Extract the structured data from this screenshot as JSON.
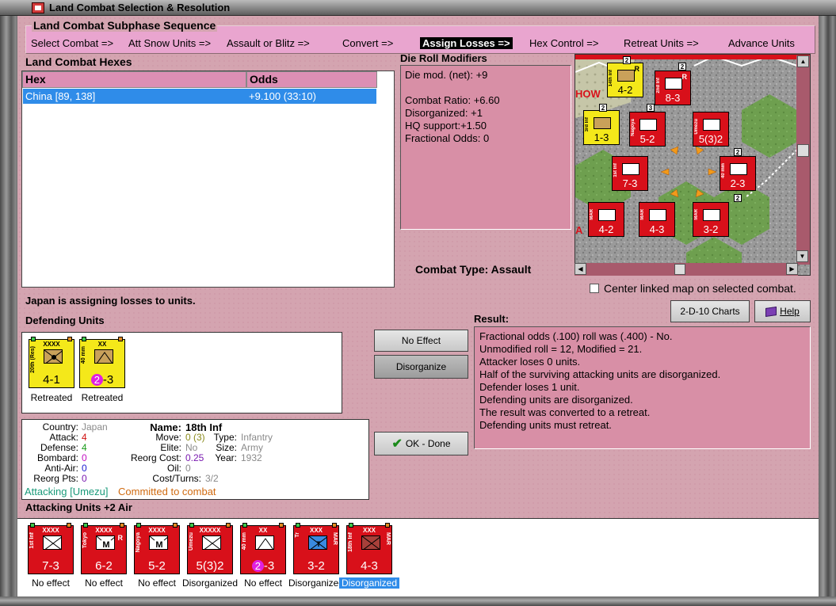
{
  "window": {
    "title": "Land Combat Selection & Resolution"
  },
  "subphase": {
    "title": "Land Combat Subphase Sequence",
    "phases": [
      "Select Combat =>",
      "Att Snow Units =>",
      "Assault or Blitz =>",
      "Convert =>",
      "Assign Losses =>",
      "Hex Control =>",
      "Retreat Units =>",
      "Advance Units"
    ],
    "active_index": 4
  },
  "hexes": {
    "title": "Land Combat Hexes",
    "columns": [
      "Hex",
      "Odds"
    ],
    "rows": [
      {
        "hex": "China [89, 138]",
        "odds": "+9.100 (33:10)"
      }
    ]
  },
  "die_roll": {
    "title": "Die Roll Modifiers",
    "lines": [
      "Die mod. (net): +9",
      "",
      "Combat Ratio: +6.60",
      "Disorganized: +1",
      "HQ support:+1.50",
      "Fractional Odds: 0"
    ]
  },
  "combat_type": "Combat Type:  Assault",
  "center_linked_label": "Center linked map on selected combat.",
  "buttons": {
    "charts": "2-D-10 Charts",
    "help": "Help",
    "no_effect": "No Effect",
    "disorganize": "Disorganize",
    "ok_done": "OK - Done"
  },
  "status_message": "Japan is assigning losses to units.",
  "defending": {
    "title": "Defending Units",
    "units": [
      {
        "size": "XXXX",
        "name": "20th (Res)",
        "strength": "4-1",
        "status": "Retreated",
        "type": "air"
      },
      {
        "size": "XX",
        "name": "40 mm",
        "strength": "2-3",
        "status": "Retreated",
        "type": "aa"
      }
    ]
  },
  "details": {
    "country_label": "Country:",
    "country": "Japan",
    "attack_label": "Attack:",
    "attack": "4",
    "defense_label": "Defense:",
    "defense": "4",
    "bombard_label": "Bombard:",
    "bombard": "0",
    "antiair_label": "Anti-Air:",
    "antiair": "0",
    "reorg_pts_label": "Reorg Pts:",
    "reorg_pts": "0",
    "name_label": "Name:",
    "name": "18th Inf",
    "move_label": "Move:",
    "move": "0 (3)",
    "type_label": "Type:",
    "type": "Infantry",
    "elite_label": "Elite:",
    "elite": "No",
    "size_label": "Size:",
    "size": "Army",
    "reorg_cost_label": "Reorg Cost:",
    "reorg_cost": "0.25",
    "year_label": "Year:",
    "year": "1932",
    "oil_label": "Oil:",
    "oil": "0",
    "cost_turns_label": "Cost/Turns:",
    "cost_turns": "3/2",
    "attacking": "Attacking [Umezu]",
    "committed": "Committed to combat"
  },
  "result": {
    "title": "Result:",
    "lines": [
      "Fractional odds (.100) roll was (.400)  - No.",
      "Unmodified roll = 12, Modified = 21.",
      "Attacker loses 0 units.",
      "Half of the surviving attacking units are disorganized.",
      "Defender loses 1 unit.",
      "Defending units are disorganized.",
      "The result was converted to a retreat.",
      "Defending units must retreat."
    ]
  },
  "attacking": {
    "title": "Attacking Units +2 Air",
    "units": [
      {
        "size": "XXXX",
        "name": "1st Inf",
        "strength": "7-3",
        "status": "No effect",
        "type": "inf"
      },
      {
        "size": "XXXX",
        "name": "Tokyo",
        "strength": "6-2",
        "status": "No effect",
        "type": "mech",
        "reserve": "R"
      },
      {
        "size": "XXXX",
        "name": "Nagoya",
        "strength": "5-2",
        "status": "No effect",
        "type": "mech"
      },
      {
        "size": "XXXXX",
        "name": "Umezu",
        "strength": "5(3)2",
        "status": "Disorganized",
        "type": "inf"
      },
      {
        "size": "XX",
        "name": "40 mm",
        "strength": "2-3",
        "status": "No effect",
        "type": "aa"
      },
      {
        "size": "XXX",
        "name": "Tr",
        "strength": "3-2",
        "status": "Disorganized",
        "type": "marine",
        "tag": "MAR"
      },
      {
        "size": "XXX",
        "name": "18th Inf",
        "strength": "4-3",
        "status": "Disorganized",
        "type": "inf",
        "tag": "MAR",
        "selected": true
      }
    ]
  },
  "map": {
    "labels": [
      "HOW",
      "A"
    ],
    "counters": [
      {
        "strength": "4-2",
        "color": "yellow",
        "name": "14th Inf",
        "reserve": "R"
      },
      {
        "strength": "8-3",
        "color": "red",
        "name": "2nd Inf",
        "reserve": "R"
      },
      {
        "strength": "1-3",
        "color": "yellow",
        "name": "3rd Inf"
      },
      {
        "strength": "5-2",
        "color": "red",
        "name": "Nagoya"
      },
      {
        "strength": "5(3)2",
        "color": "red",
        "name": "Umezu"
      },
      {
        "strength": "7-3",
        "color": "red",
        "name": "1st Inf"
      },
      {
        "strength": "2-3",
        "color": "red",
        "name": "40 mm"
      },
      {
        "strength": "4-2",
        "color": "red",
        "name": "MAR"
      },
      {
        "strength": "4-3",
        "color": "red",
        "name": "MAR"
      },
      {
        "strength": "3-2",
        "color": "red",
        "name": "MAR"
      }
    ],
    "stack_counts": [
      "2",
      "2",
      "2",
      "3",
      "2",
      "2"
    ]
  }
}
